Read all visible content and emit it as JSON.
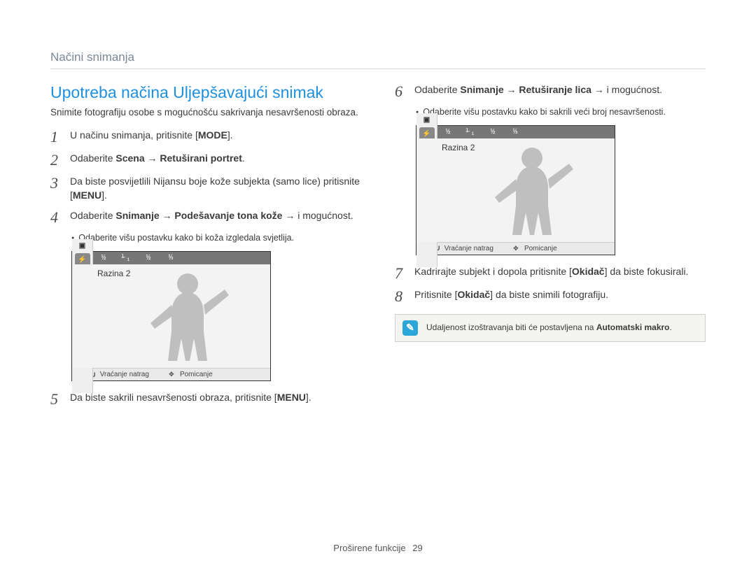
{
  "header": {
    "section": "Načini snimanja"
  },
  "title": "Upotreba načina Uljepšavajući snimak",
  "intro": "Snimite fotografiju osobe s mogućnošću sakrivanja nesavršenosti obraza.",
  "keycaps": {
    "mode": "MODE",
    "menu": "MENU",
    "okidac": "Okidač"
  },
  "left_steps": {
    "1": {
      "pre": "U načinu snimanja, pritisnite [",
      "post": "]."
    },
    "2": {
      "pre": "Odaberite ",
      "bold": "Scena → Retuširani portret",
      "post": "."
    },
    "3": {
      "line1": "Da biste posvijetlili Nijansu boje kože subjekta (samo lice) pritisnite [",
      "line1_post": "]."
    },
    "4": {
      "pre": "Odaberite ",
      "bold": "Snimanje → Podešavanje tona kože →",
      "post": " i mogućnost."
    },
    "4_bullet": "Odaberite višu postavku kako bi koža izgledala svjetlija.",
    "5": {
      "pre": "Da biste sakrili nesavršenosti obraza, pritisnite [",
      "post": "]."
    }
  },
  "right_steps": {
    "6": {
      "pre": "Odaberite ",
      "bold": "Snimanje → Retuširanje lica →",
      "post": " i mogućnost."
    },
    "6_bullet": "Odaberite višu postavku kako bi sakrili veći broj nesavršenosti.",
    "7": {
      "pre": "Kadrirajte subjekt i dopola pritisnite [",
      "post": "] da biste fokusirali."
    },
    "8": {
      "pre": "Pritisnite [",
      "post": "] da biste snimili fotografiju."
    }
  },
  "camera": {
    "topbar": [
      "½",
      "⅟₁",
      "½",
      "⅓"
    ],
    "level_label": "Razina 2",
    "footer_menu": "MENU",
    "footer_back": "Vraćanje natrag",
    "footer_move": "Pomicanje"
  },
  "note": {
    "text_pre": "Udaljenost izoštravanja biti će postavljena na ",
    "text_bold": "Automatski makro",
    "text_post": "."
  },
  "footer": {
    "label": "Proširene funkcije",
    "page": "29"
  }
}
